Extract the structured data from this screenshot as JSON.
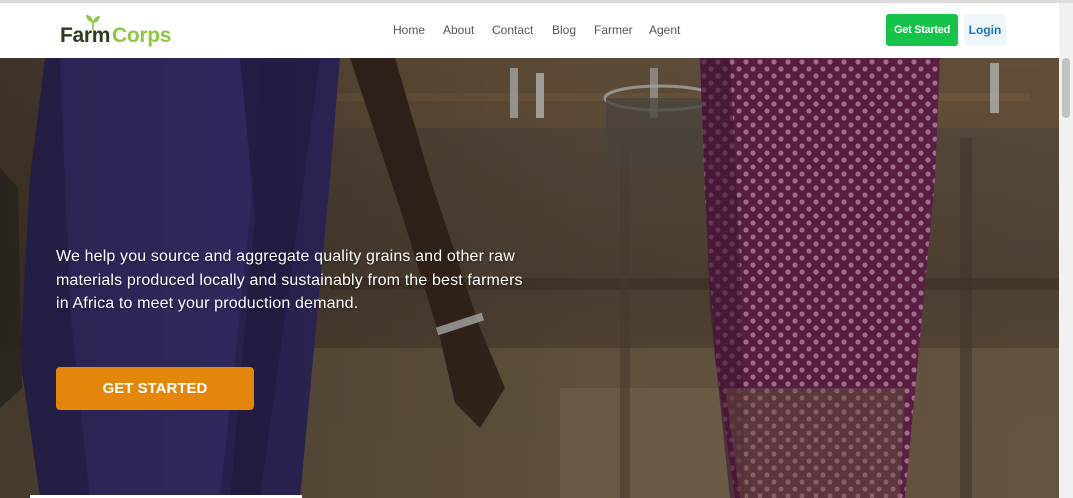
{
  "brand": {
    "name_part1": "Farm",
    "name_part2": "Corps",
    "logo_icon": "sprout-icon"
  },
  "nav": {
    "links": [
      "Home",
      "About",
      "Contact",
      "Blog",
      "Farmer",
      "Agent"
    ],
    "get_started_label": "Get Started",
    "login_label": "Login"
  },
  "hero": {
    "description": "We help you source and aggregate quality grains and other raw materials produced locally and sustainably from the best farmers in Africa to meet your production demand.",
    "cta_label": "GET STARTED",
    "image": "farmers-carrying-grain-photo"
  },
  "colors": {
    "primary_green": "#16c24a",
    "logo_green": "#8dc63f",
    "logo_dark": "#2e3b1f",
    "cta_orange": "#e4860c",
    "login_blue": "#1877c7"
  }
}
